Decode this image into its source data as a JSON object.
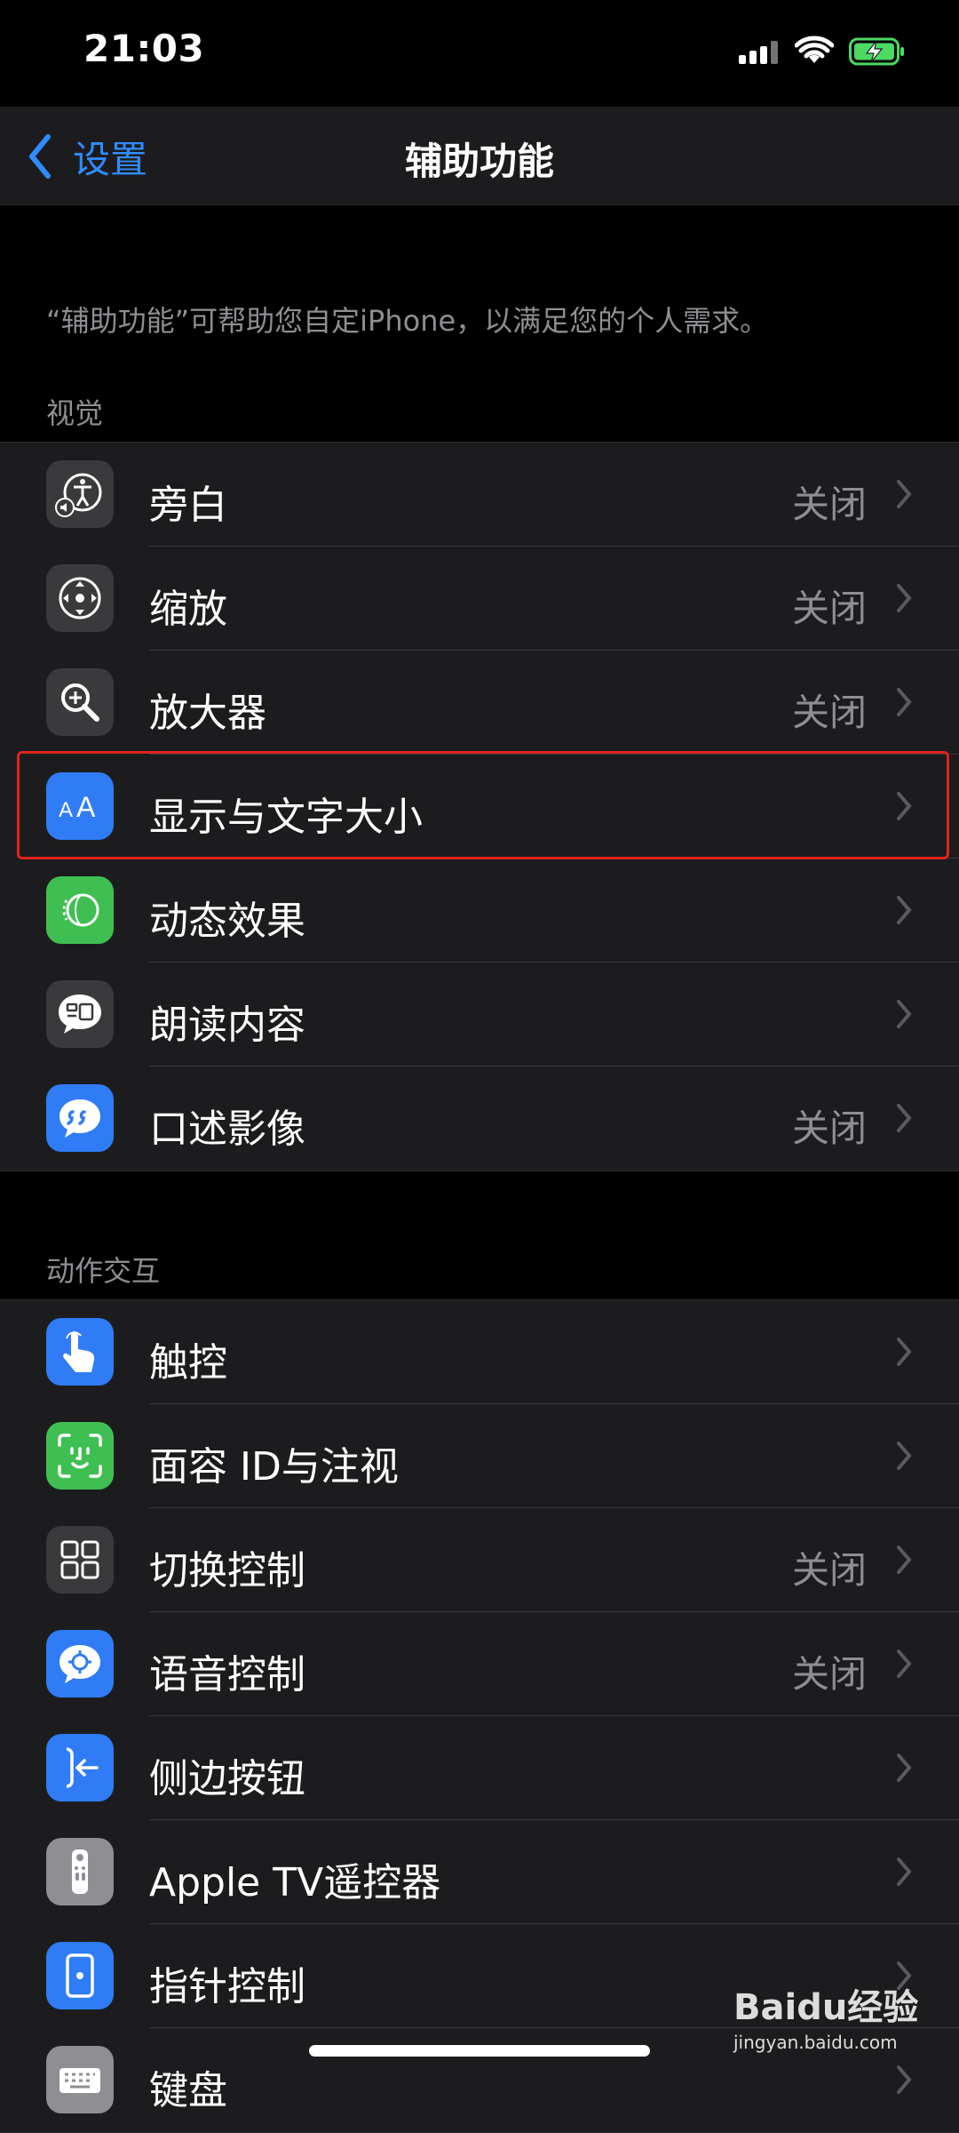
{
  "status": {
    "time": "21:03"
  },
  "nav": {
    "back_label": "设置",
    "title": "辅助功能"
  },
  "description": "“辅助功能”可帮助您自定iPhone，以满足您的个人需求。",
  "sections": {
    "vision": {
      "header": "视觉",
      "items": [
        {
          "label": "旁白",
          "value": "关闭",
          "icon": "voiceover-icon",
          "icon_bg": "#3a3a3c"
        },
        {
          "label": "缩放",
          "value": "关闭",
          "icon": "zoom-icon",
          "icon_bg": "#3a3a3c"
        },
        {
          "label": "放大器",
          "value": "关闭",
          "icon": "magnifier-icon",
          "icon_bg": "#3a3a3c"
        },
        {
          "label": "显示与文字大小",
          "value": "",
          "icon": "text-size-icon",
          "icon_bg": "#2f7cf6"
        },
        {
          "label": "动态效果",
          "value": "",
          "icon": "motion-icon",
          "icon_bg": "#3fbf52"
        },
        {
          "label": "朗读内容",
          "value": "",
          "icon": "spoken-content-icon",
          "icon_bg": "#3a3a3c"
        },
        {
          "label": "口述影像",
          "value": "关闭",
          "icon": "audio-description-icon",
          "icon_bg": "#2f7cf6"
        }
      ]
    },
    "interaction": {
      "header": "动作交互",
      "items": [
        {
          "label": "触控",
          "value": "",
          "icon": "touch-icon",
          "icon_bg": "#2f7cf6"
        },
        {
          "label": "面容 ID与注视",
          "value": "",
          "icon": "face-id-icon",
          "icon_bg": "#3fbf52"
        },
        {
          "label": "切换控制",
          "value": "关闭",
          "icon": "switch-control-icon",
          "icon_bg": "#3a3a3c"
        },
        {
          "label": "语音控制",
          "value": "关闭",
          "icon": "voice-control-icon",
          "icon_bg": "#2f7cf6"
        },
        {
          "label": "侧边按钮",
          "value": "",
          "icon": "side-button-icon",
          "icon_bg": "#2f7cf6"
        },
        {
          "label": "Apple TV遥控器",
          "value": "",
          "icon": "apple-tv-remote-icon",
          "icon_bg": "#8e8e93"
        },
        {
          "label": "指针控制",
          "value": "",
          "icon": "pointer-control-icon",
          "icon_bg": "#2f7cf6"
        },
        {
          "label": "键盘",
          "value": "",
          "icon": "keyboard-icon",
          "icon_bg": "#8e8e93"
        }
      ]
    }
  },
  "watermark": {
    "brand": "Baidu经验",
    "site": "jingyan.baidu.com"
  },
  "colors": {
    "accent": "#2f8cff",
    "highlight": "#e0231c",
    "battery": "#4cd964"
  }
}
